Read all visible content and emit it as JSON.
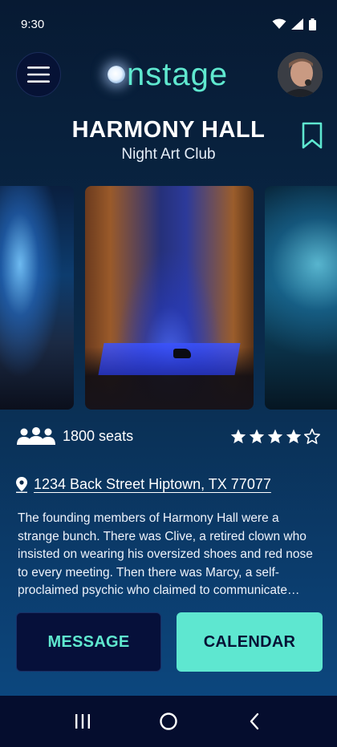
{
  "status_bar": {
    "time": "9:30"
  },
  "header": {
    "logo_text": "nstage"
  },
  "venue": {
    "name": "HARMONY HALL",
    "type": "Night Art Club",
    "seats": "1800 seats",
    "rating": 4,
    "rating_max": 5,
    "address": "1234 Back Street Hiptown, TX 77077",
    "description": "The founding members of Harmony Hall were a strange bunch. There was Clive, a retired clown who insisted on wearing his oversized shoes and red nose to every meeting. Then there was Marcy, a self-proclaimed psychic who claimed to communicate…"
  },
  "actions": {
    "message_label": "MESSAGE",
    "calendar_label": "CALENDAR"
  },
  "colors": {
    "accent": "#5ee7d0",
    "dark_button": "#06103a",
    "nav_bg": "#050d2e"
  },
  "icons": [
    "hamburger-menu-icon",
    "bookmark-icon",
    "people-icon",
    "star-icon",
    "location-pin-icon",
    "recent-apps-icon",
    "home-icon",
    "back-icon"
  ]
}
